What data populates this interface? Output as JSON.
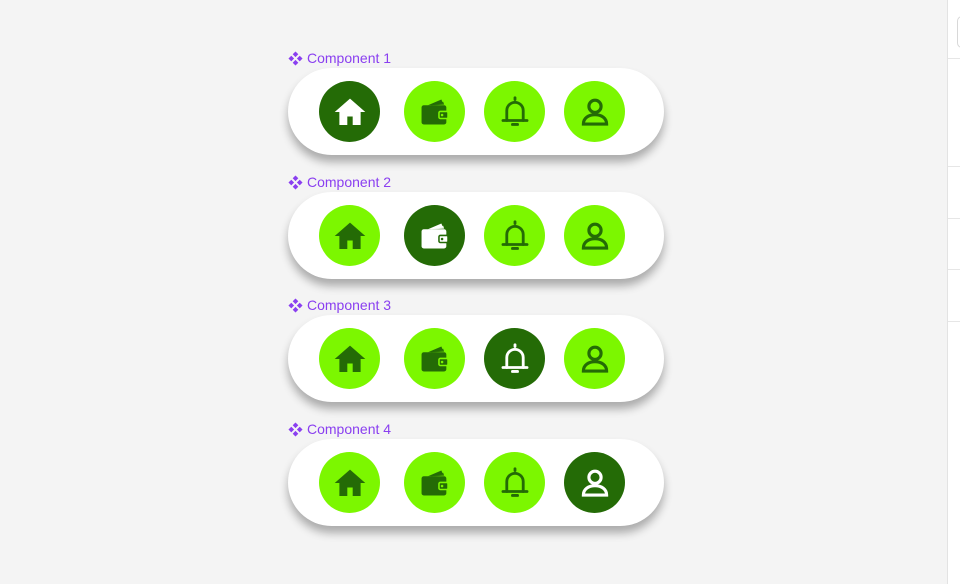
{
  "colors": {
    "background": "#f4f4f4",
    "bar": "#ffffff",
    "label": "#8a3ff0",
    "active_fill": "#246b06",
    "active_icon": "#ffffff",
    "inactive_fill": "#7cf700",
    "inactive_icon": "#246b06"
  },
  "nav_items": [
    {
      "icon": "home-icon"
    },
    {
      "icon": "wallet-icon"
    },
    {
      "icon": "bell-icon"
    },
    {
      "icon": "user-icon"
    }
  ],
  "components": [
    {
      "label": "Component 1",
      "active_index": 0
    },
    {
      "label": "Component 2",
      "active_index": 1
    },
    {
      "label": "Component 3",
      "active_index": 2
    },
    {
      "label": "Component 4",
      "active_index": 3
    }
  ]
}
